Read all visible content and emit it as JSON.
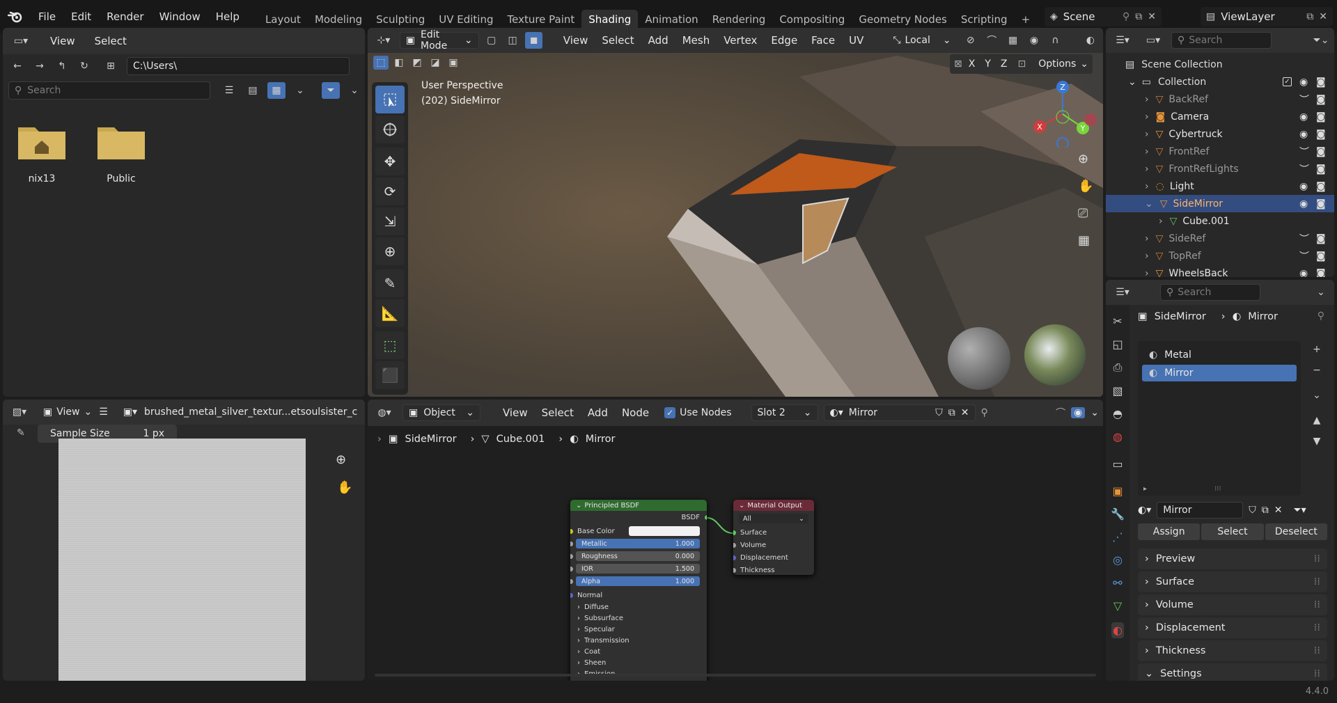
{
  "topbar": {
    "menus": [
      "File",
      "Edit",
      "Render",
      "Window",
      "Help"
    ],
    "workspaces": [
      "Layout",
      "Modeling",
      "Sculpting",
      "UV Editing",
      "Texture Paint",
      "Shading",
      "Animation",
      "Rendering",
      "Compositing",
      "Geometry Nodes",
      "Scripting"
    ],
    "active_workspace": "Shading",
    "add_tab": "+",
    "scene": "Scene",
    "view_layer": "ViewLayer"
  },
  "file_browser": {
    "menus": [
      "View",
      "Select"
    ],
    "path": "C:\\Users\\",
    "search_placeholder": "Search",
    "folders": [
      {
        "name": "nix13",
        "icon": "home-folder-icon"
      },
      {
        "name": "Public",
        "icon": "folder-icon"
      }
    ]
  },
  "image_editor": {
    "view_label": "View",
    "image_name": "brushed_metal_silver_textur...etsoulsister_c",
    "sample_size_label": "Sample Size",
    "sample_size_value": "1 px"
  },
  "viewport": {
    "mode": "Edit Mode",
    "menus": [
      "View",
      "Select",
      "Add",
      "Mesh",
      "Vertex",
      "Edge",
      "Face",
      "UV"
    ],
    "transform_orientation": "Local",
    "options_label": "Options",
    "axes": [
      "X",
      "Y",
      "Z"
    ],
    "perspective_label": "User Perspective",
    "object_label": "(202) SideMirror",
    "gizmo": {
      "x": "X",
      "y": "Y",
      "z": "Z"
    }
  },
  "node_editor": {
    "object_mode": "Object",
    "menus": [
      "View",
      "Select",
      "Add",
      "Node"
    ],
    "use_nodes_label": "Use Nodes",
    "slot": "Slot 2",
    "material": "Mirror",
    "breadcrumb": [
      "SideMirror",
      "Cube.001",
      "Mirror"
    ],
    "bsdf_node": {
      "title": "Principled BSDF",
      "output": "BSDF",
      "base_color_label": "Base Color",
      "sliders": [
        {
          "label": "Metallic",
          "value": "1.000",
          "fill": 1.0
        },
        {
          "label": "Roughness",
          "value": "0.000",
          "fill": 0.0
        },
        {
          "label": "IOR",
          "value": "1.500",
          "fill": 0.0
        },
        {
          "label": "Alpha",
          "value": "1.000",
          "fill": 1.0
        }
      ],
      "normal_label": "Normal",
      "panels": [
        "Diffuse",
        "Subsurface",
        "Specular",
        "Transmission",
        "Coat",
        "Sheen",
        "Emission"
      ]
    },
    "output_node": {
      "title": "Material Output",
      "target": "All",
      "inputs": [
        "Surface",
        "Volume",
        "Displacement",
        "Thickness"
      ]
    }
  },
  "outliner": {
    "search_placeholder": "Search",
    "scene_collection": "Scene Collection",
    "collection": "Collection",
    "items": [
      {
        "name": "BackRef",
        "dim": true
      },
      {
        "name": "Camera",
        "dim": false
      },
      {
        "name": "Cybertruck",
        "dim": false
      },
      {
        "name": "FrontRef",
        "dim": true
      },
      {
        "name": "FrontRefLights",
        "dim": true
      },
      {
        "name": "Light",
        "dim": false
      },
      {
        "name": "SideMirror",
        "dim": false,
        "selected": true
      },
      {
        "name": "Cube.001",
        "dim": false,
        "child": true
      },
      {
        "name": "SideRef",
        "dim": true
      },
      {
        "name": "TopRef",
        "dim": true
      },
      {
        "name": "WheelsBack",
        "dim": false
      }
    ]
  },
  "properties": {
    "search_placeholder": "Search",
    "breadcrumb_object": "SideMirror",
    "breadcrumb_material": "Mirror",
    "slots": [
      "Metal",
      "Mirror"
    ],
    "selected_slot": "Mirror",
    "material_name": "Mirror",
    "buttons": [
      "Assign",
      "Select",
      "Deselect"
    ],
    "sections": [
      "Preview",
      "Surface",
      "Volume",
      "Displacement",
      "Thickness",
      "Settings"
    ]
  },
  "statusbar": {
    "version": "4.4.0"
  },
  "colors": {
    "accent": "#4772b3",
    "selected_row": "#334d80",
    "bsdf_header": "#2f6b2f",
    "output_header": "#6b2a37"
  }
}
